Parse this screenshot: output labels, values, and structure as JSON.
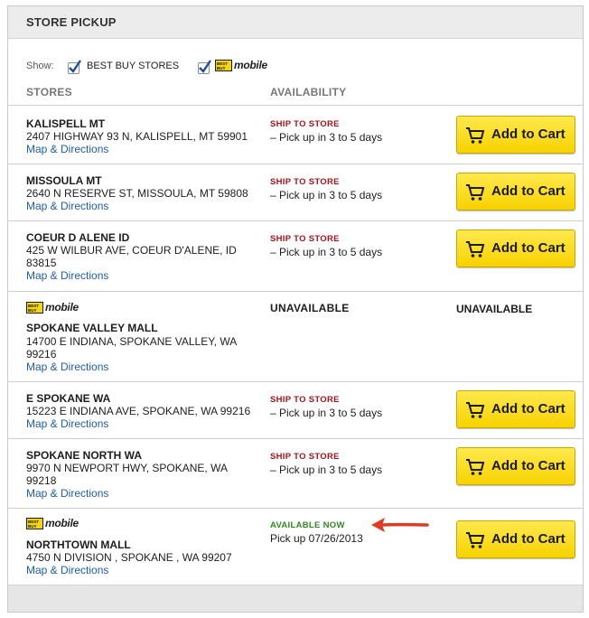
{
  "panel": {
    "title": "STORE PICKUP"
  },
  "filters": {
    "show_label": "Show:",
    "best_buy_label": "BEST BUY STORES",
    "best_buy_checked": true,
    "mobile_checked": true,
    "mobile_logo_text": "mobile",
    "mobile_logo_tag": "BEST BUY"
  },
  "columns": {
    "stores": "STORES",
    "availability": "AVAILABILITY"
  },
  "stores": [
    {
      "name": "KALISPELL MT",
      "address": "2407 HIGHWAY 93 N, KALISPELL, MT 59901",
      "link": "Map & Directions",
      "status": "SHIP TO STORE",
      "detail": "– Pick up in 3 to 5 days",
      "button": "Add to Cart"
    },
    {
      "name": "MISSOULA MT",
      "address": "2640 N RESERVE ST, MISSOULA, MT 59808",
      "link": "Map & Directions",
      "status": "SHIP TO STORE",
      "detail": "– Pick up in 3 to 5 days",
      "button": "Add to Cart"
    },
    {
      "name": "COEUR D ALENE ID",
      "address": "425 W WILBUR AVE, COEUR D'ALENE, ID 83815",
      "link": "Map & Directions",
      "status": "SHIP TO STORE",
      "detail": "– Pick up in 3 to 5 days",
      "button": "Add to Cart"
    },
    {
      "name": "SPOKANE VALLEY MALL",
      "address": "14700 E INDIANA, SPOKANE VALLEY, WA 99216",
      "link": "Map & Directions",
      "status": "UNAVAILABLE",
      "right_status": "UNAVAILABLE",
      "logo_text": "mobile",
      "logo_tag": "BEST BUY"
    },
    {
      "name": "E SPOKANE WA",
      "address": "15223 E INDIANA AVE, SPOKANE, WA 99216",
      "link": "Map & Directions",
      "status": "SHIP TO STORE",
      "detail": "– Pick up in 3 to 5 days",
      "button": "Add to Cart"
    },
    {
      "name": "SPOKANE NORTH WA",
      "address": "9970 N NEWPORT HWY, SPOKANE, WA 99218",
      "link": "Map & Directions",
      "status": "SHIP TO STORE",
      "detail": "– Pick up in 3 to 5 days",
      "button": "Add to Cart"
    },
    {
      "name": "NORTHTOWN MALL",
      "address": "4750 N DIVISION , SPOKANE , WA 99207",
      "link": "Map & Directions",
      "status": "AVAILABLE NOW",
      "detail": "Pick up  07/26/2013",
      "button": "Add to Cart",
      "logo_text": "mobile",
      "logo_tag": "BEST BUY"
    }
  ],
  "colors": {
    "ship": "#a3141c",
    "available": "#2f8a1e",
    "link": "#1d5ea8",
    "button": "#f7d200",
    "annotation_arrow": "#e23a22"
  },
  "icons": {
    "cart": "shopping-cart-icon",
    "checkbox": "checkbox-checked-icon",
    "annotation": "red-arrow-icon"
  }
}
